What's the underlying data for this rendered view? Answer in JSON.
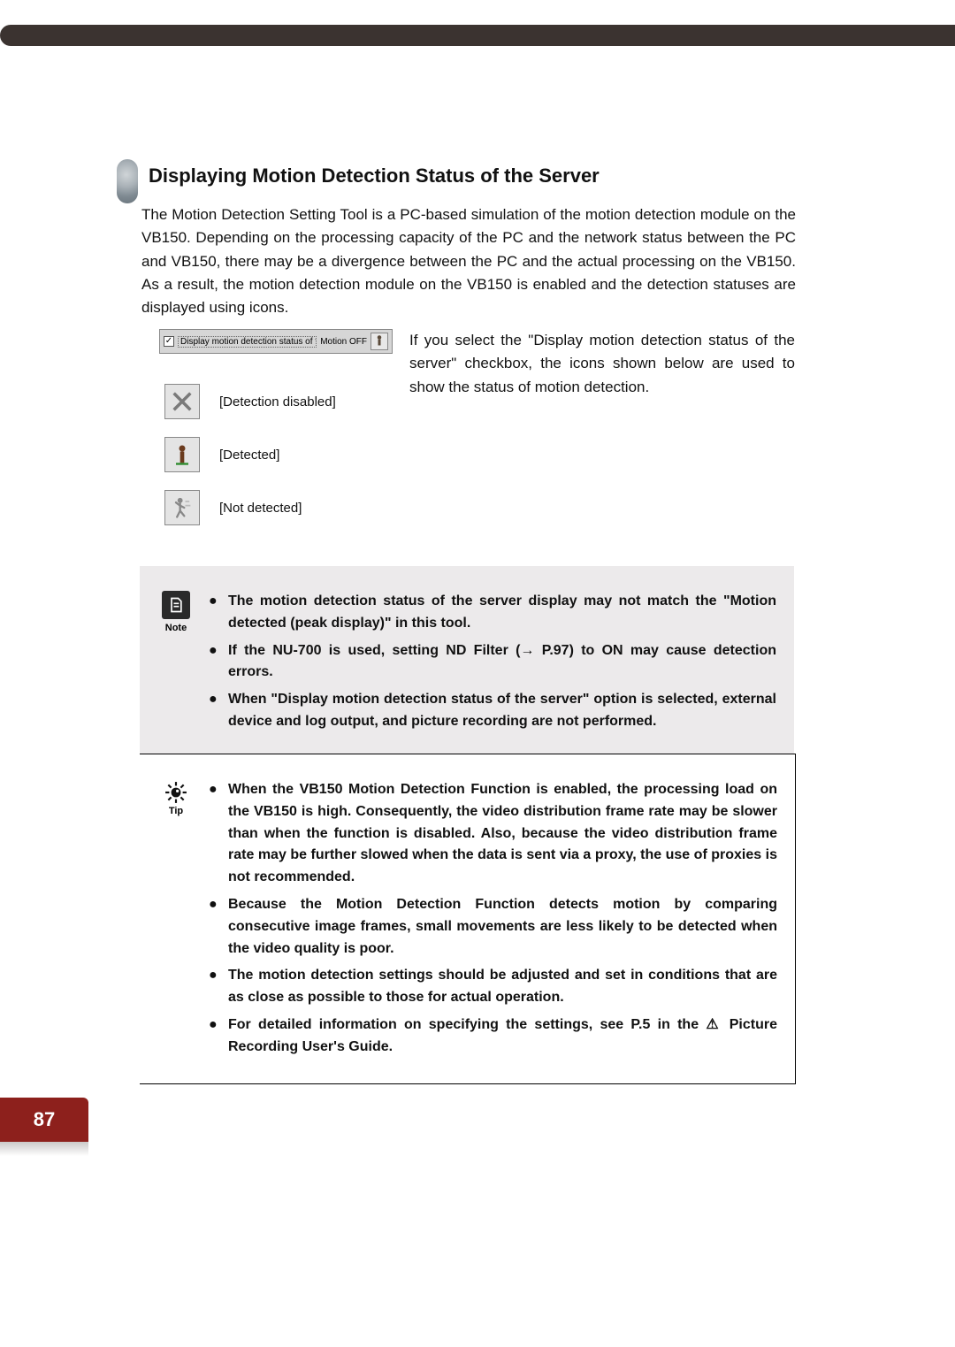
{
  "page_number": "87",
  "section_title": "Displaying Motion Detection Status of the Server",
  "intro_text": "The Motion Detection Setting Tool is a PC-based simulation of the motion detection module on the VB150. Depending on the processing capacity of the PC and the network status between the PC and VB150, there may be a divergence between the PC and the actual processing on the VB150. As a result, the motion detection module on the VB150 is enabled and the detection statuses are displayed using icons.",
  "checkbox_strip": {
    "checked": "✓",
    "label": "Display motion detection status of the server",
    "status": "Motion OFF"
  },
  "checkbox_desc": "If you select the \"Display motion detection status of the server\" checkbox, the icons shown below are used to show the status of motion detection.",
  "status_icons": {
    "disabled": "[Detection disabled]",
    "detected": "[Detected]",
    "not_detected": "[Not detected]"
  },
  "note": {
    "label": "Note",
    "items": [
      "The motion detection status of the server display may not match the \"Motion detected (peak display)\" in this tool.",
      "If the NU-700 is used, setting ND Filter (→ P.97) to ON may cause detection errors.",
      "When \"Display motion detection status of the server\" option is selected, external device and log output, and picture recording are not performed."
    ]
  },
  "tip": {
    "label": "Tip",
    "items": [
      "When the VB150 Motion Detection Function is enabled, the processing load on the VB150 is high. Consequently, the video distribution frame rate may be slower than when the function is disabled. Also, because the video distribution frame rate may be further slowed when the data is sent via a proxy, the use of proxies is not recommended.",
      "Because the Motion Detection Function detects motion by comparing consecutive image frames, small movements are less likely to be detected when the video quality is poor.",
      "The motion detection settings should be adjusted and set in conditions that are as close as possible to those for actual operation.",
      "For detailed information on specifying the settings, see P.5 in the ⚠ Picture Recording User's Guide."
    ]
  }
}
